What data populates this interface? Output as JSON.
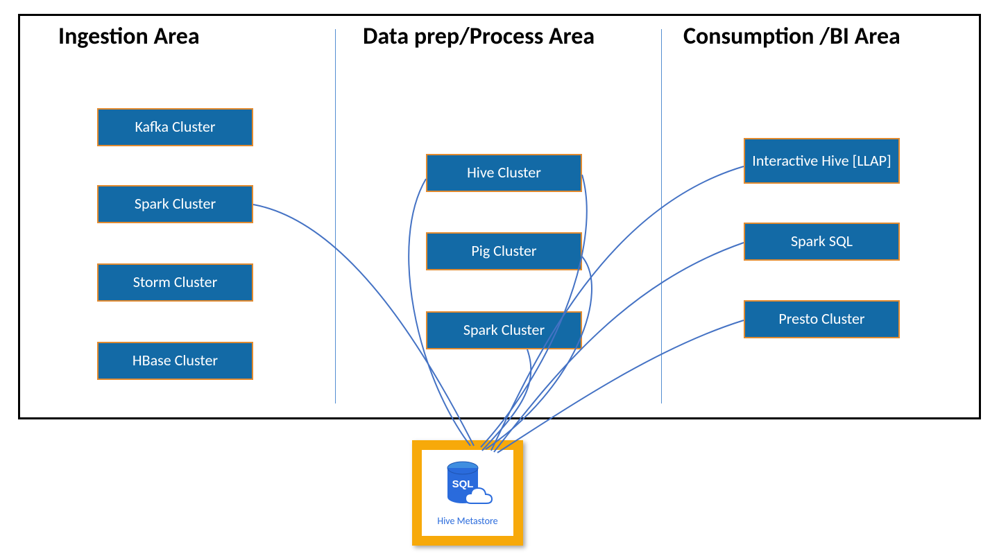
{
  "columns": {
    "ingestion": {
      "title": "Ingestion Area"
    },
    "process": {
      "title": "Data prep/Process Area"
    },
    "consume": {
      "title": "Consumption /BI Area"
    }
  },
  "boxes": {
    "kafka": "Kafka Cluster",
    "spark1": "Spark Cluster",
    "storm": "Storm Cluster",
    "hbase": "HBase Cluster",
    "hive": "Hive Cluster",
    "pig": "Pig Cluster",
    "spark2": "Spark Cluster",
    "llap": "Interactive Hive [LLAP]",
    "ssql": "Spark SQL",
    "presto": "Presto Cluster"
  },
  "metastore": {
    "label": "Hive Metastore",
    "sql_text": "SQL"
  }
}
